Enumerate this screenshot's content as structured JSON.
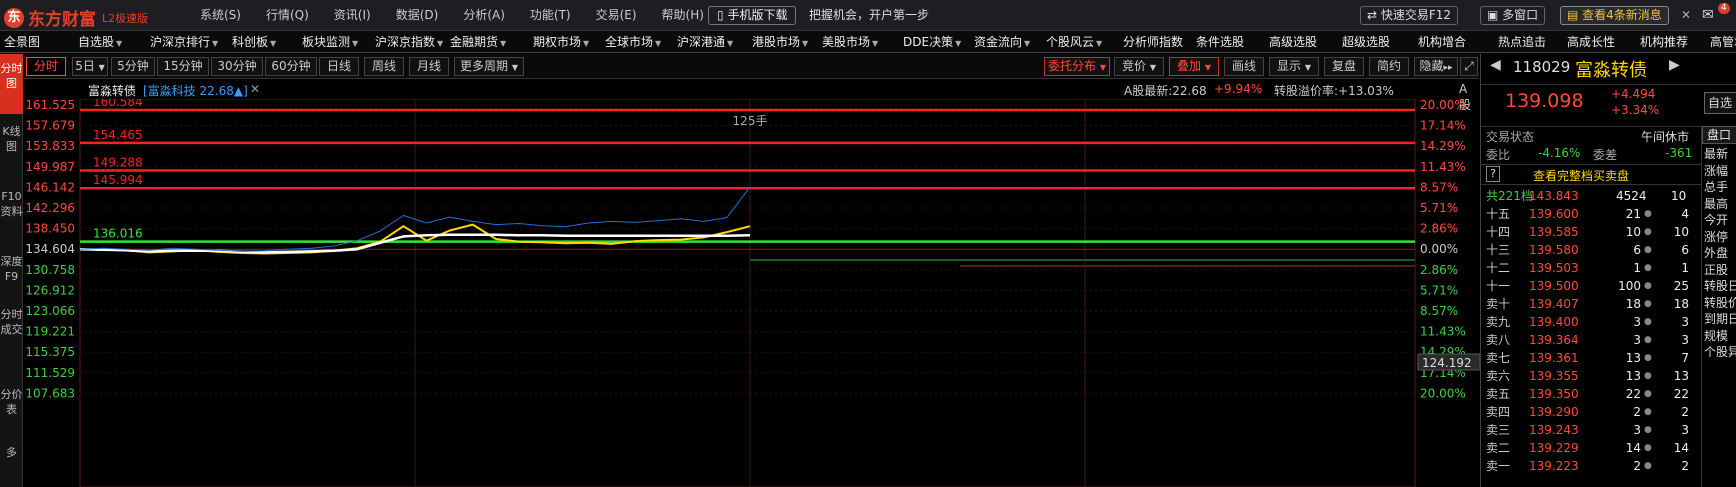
{
  "brand": {
    "mark": "东",
    "name": "东方财富",
    "version": "L2极速版"
  },
  "menu": [
    "系统(S)",
    "行情(Q)",
    "资讯(I)",
    "数据(D)",
    "分析(A)",
    "功能(T)",
    "交易(E)",
    "帮助(H)"
  ],
  "topbar": {
    "mobile_label": "手机版下载",
    "slogan": "把握机会，开户第一步",
    "quick_trade": "快速交易F12",
    "multi_window": "多窗口",
    "news": "查看4条新消息",
    "news_close": "✕",
    "mail_badge": "4"
  },
  "nav": [
    "全景图",
    "自选股",
    "沪深京排行",
    "科创板",
    "板块监测",
    "沪深京指数",
    "金融期货",
    "期权市场",
    "全球市场",
    "沪深港通",
    "港股市场",
    "美股市场",
    "DDE决策",
    "资金流向",
    "个股风云",
    "分析师指数",
    "条件选股",
    "高级选股",
    "超级选股",
    "机构增合",
    "热点追击",
    "高成长性",
    "机构推荐",
    "高管增持"
  ],
  "nav_dropdown": [
    false,
    true,
    true,
    true,
    true,
    true,
    true,
    true,
    true,
    true,
    true,
    true,
    true,
    true,
    true,
    false,
    false,
    false,
    false,
    false,
    false,
    false,
    false,
    false
  ],
  "left_tabs": [
    "分时图",
    "K线图",
    "F10资料",
    "深度F9",
    "分时成交",
    "分价表",
    "多"
  ],
  "periods": [
    "分时",
    "5日",
    "5分钟",
    "15分钟",
    "30分钟",
    "60分钟",
    "日线",
    "周线",
    "月线",
    "更多周期"
  ],
  "tools": {
    "order_dist": "委托分布",
    "bidding": "竞价",
    "overlay": "叠加",
    "draw": "画线",
    "display": "显示",
    "replay": "复盘",
    "simple": "简约",
    "hide": "隐藏"
  },
  "info": {
    "name": "富淼转债",
    "related": "[富淼科技 22.68▲]",
    "close": "✕",
    "a_stock_price": "A股最新:22.68",
    "a_stock_change": "+9.94%",
    "premium": "转股溢价率:+13.03%",
    "tail": "A股"
  },
  "chart": {
    "volume_label": "125手",
    "cursor_price": "124.192",
    "left_ticks": [
      "161.525",
      "157.679",
      "153.833",
      "149.987",
      "146.142",
      "142.296",
      "138.450",
      "134.604",
      "130.758",
      "126.912",
      "123.066",
      "119.221",
      "115.375",
      "111.529",
      "107.683"
    ],
    "right_ticks": [
      "20.00%",
      "17.14%",
      "14.29%",
      "11.43%",
      "8.57%",
      "5.71%",
      "2.86%",
      "0.00%",
      "2.86%",
      "5.71%",
      "8.57%",
      "11.43%",
      "14.29%",
      "17.14%",
      "20.00%"
    ],
    "levels": [
      {
        "label": "160.584",
        "price": 160.584,
        "color": "#ff2020"
      },
      {
        "label": "154.465",
        "price": 154.465,
        "color": "#ff2020"
      },
      {
        "label": "149.288",
        "price": 149.288,
        "color": "#ff2020"
      },
      {
        "label": "145.994",
        "price": 145.994,
        "color": "#ff2020"
      },
      {
        "label": "136.016",
        "price": 136.016,
        "color": "#33e633"
      }
    ]
  },
  "chart_data": {
    "type": "line",
    "ylim": [
      107.683,
      161.525
    ],
    "prev_close": 134.604,
    "series": [
      {
        "values": [
          134.6,
          134.5,
          134.4,
          134.0,
          134.2,
          134.4,
          134.1,
          133.9,
          133.8,
          133.9,
          134.0,
          134.3,
          134.8,
          136.0,
          138.9,
          136.2,
          138.1,
          139.2,
          136.5,
          136.0,
          135.9,
          135.7,
          135.8,
          135.6,
          136.1,
          136.3,
          136.4,
          136.8,
          137.8,
          138.9
        ]
      },
      {
        "values": [
          134.6,
          134.5,
          134.4,
          134.2,
          134.3,
          134.3,
          134.3,
          134.1,
          134.0,
          134.1,
          134.2,
          134.3,
          134.6,
          135.8,
          137.0,
          137.2,
          137.3,
          137.3,
          137.3,
          137.2,
          137.2,
          137.1,
          137.1,
          137.1,
          137.1,
          137.1,
          137.1,
          137.1,
          137.1,
          137.2
        ]
      },
      {
        "values": [
          134.6,
          134.8,
          134.6,
          134.4,
          134.8,
          134.6,
          134.4,
          134.2,
          134.3,
          134.6,
          134.8,
          135.2,
          136.2,
          138.0,
          140.9,
          139.5,
          140.6,
          139.8,
          139.2,
          139.4,
          139.0,
          138.8,
          139.5,
          139.8,
          139.6,
          139.9,
          140.3,
          139.8,
          140.5,
          146.2
        ]
      }
    ]
  },
  "quote": {
    "code": "118029",
    "name": "富淼转债",
    "price": "139.098",
    "change": "+4.494",
    "pct": "+3.34%",
    "side_label": "自选",
    "trade_state_label": "交易状态",
    "trade_state": "午间休市",
    "tab": "盘口",
    "ratio_label": "委比",
    "ratio": "-4.16%",
    "diff_label": "委差",
    "diff": "-361",
    "full_book": "查看完整档买卖盘",
    "q": "?",
    "total_label": "共221档",
    "total_price": "143.843",
    "total_vol": "4524",
    "total_cnt": "10",
    "asks": [
      {
        "label": "十五",
        "price": "139.600",
        "vol": "21",
        "cnt": "4"
      },
      {
        "label": "十四",
        "price": "139.585",
        "vol": "10",
        "cnt": "10"
      },
      {
        "label": "十三",
        "price": "139.580",
        "vol": "6",
        "cnt": "6"
      },
      {
        "label": "十二",
        "price": "139.503",
        "vol": "1",
        "cnt": "1"
      },
      {
        "label": "十一",
        "price": "139.500",
        "vol": "100",
        "cnt": "25"
      },
      {
        "label": "卖十",
        "price": "139.407",
        "vol": "18",
        "cnt": "18"
      },
      {
        "label": "卖九",
        "price": "139.400",
        "vol": "3",
        "cnt": "3"
      },
      {
        "label": "卖八",
        "price": "139.364",
        "vol": "3",
        "cnt": "3"
      },
      {
        "label": "卖七",
        "price": "139.361",
        "vol": "13",
        "cnt": "7"
      },
      {
        "label": "卖六",
        "price": "139.355",
        "vol": "13",
        "cnt": "13"
      },
      {
        "label": "卖五",
        "price": "139.350",
        "vol": "22",
        "cnt": "22"
      },
      {
        "label": "卖四",
        "price": "139.290",
        "vol": "2",
        "cnt": "2"
      },
      {
        "label": "卖三",
        "price": "139.243",
        "vol": "3",
        "cnt": "3"
      },
      {
        "label": "卖二",
        "price": "139.229",
        "vol": "14",
        "cnt": "14"
      },
      {
        "label": "卖一",
        "price": "139.223",
        "vol": "2",
        "cnt": "2"
      }
    ],
    "side_items": [
      "最新",
      "涨幅",
      "总手",
      "最高",
      "今开",
      "涨停",
      "外盘",
      "正股",
      "转股日",
      "转股价",
      "到期日",
      "规模",
      "个股异"
    ]
  }
}
